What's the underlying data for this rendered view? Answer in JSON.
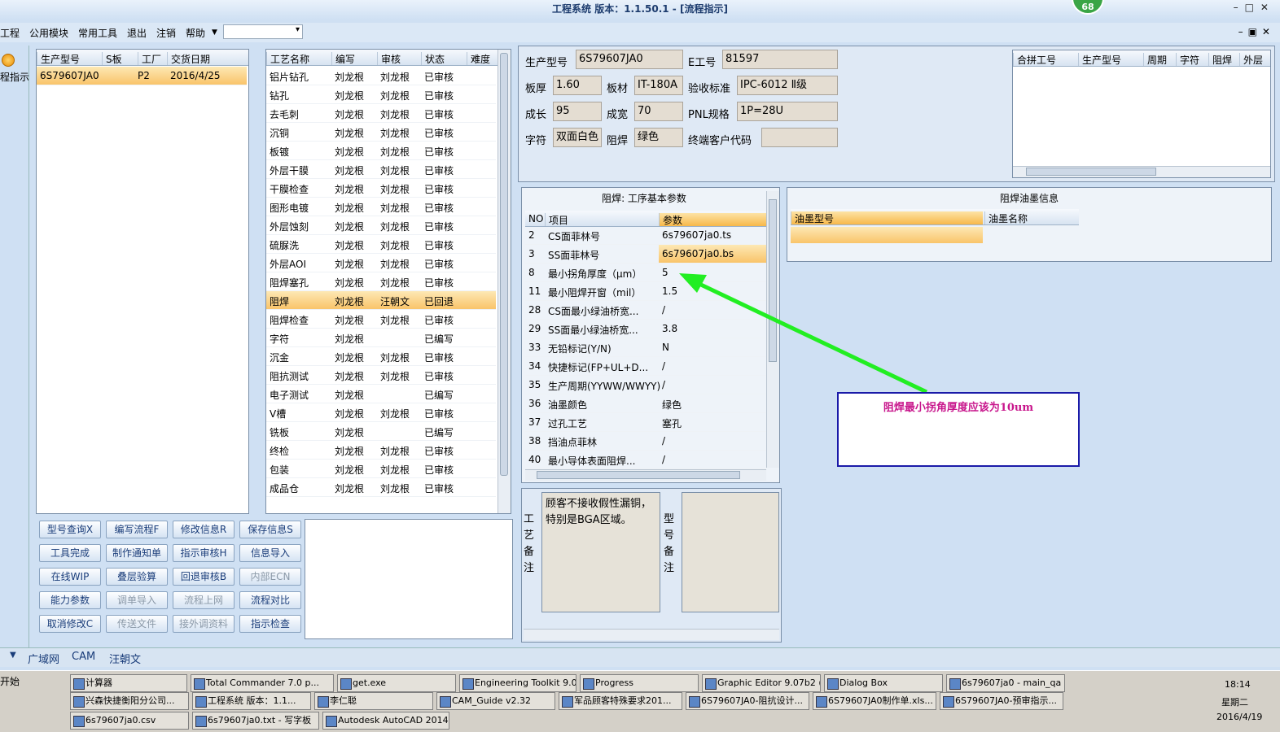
{
  "window": {
    "title": "工程系统   版本：1.1.50.1 - [流程指示]",
    "badge": "68"
  },
  "menu": {
    "items": [
      "工程",
      "公用模块",
      "常用工具",
      "退出",
      "注销",
      "帮助"
    ]
  },
  "sidebar": {
    "label": "程指示"
  },
  "orders": {
    "headers": [
      "生产型号",
      "S板",
      "工厂",
      "交货日期"
    ],
    "rows": [
      [
        "6S79607JA0",
        "",
        "P2",
        "2016/4/25"
      ]
    ]
  },
  "process": {
    "headers": [
      "工艺名称",
      "编写",
      "审核",
      "状态",
      "难度"
    ],
    "rows": [
      [
        "铝片钻孔",
        "刘龙根",
        "刘龙根",
        "已审核"
      ],
      [
        "钻孔",
        "刘龙根",
        "刘龙根",
        "已审核"
      ],
      [
        "去毛刺",
        "刘龙根",
        "刘龙根",
        "已审核"
      ],
      [
        "沉铜",
        "刘龙根",
        "刘龙根",
        "已审核"
      ],
      [
        "板镀",
        "刘龙根",
        "刘龙根",
        "已审核"
      ],
      [
        "外层干膜",
        "刘龙根",
        "刘龙根",
        "已审核"
      ],
      [
        "干膜检查",
        "刘龙根",
        "刘龙根",
        "已审核"
      ],
      [
        "图形电镀",
        "刘龙根",
        "刘龙根",
        "已审核"
      ],
      [
        "外层蚀刻",
        "刘龙根",
        "刘龙根",
        "已审核"
      ],
      [
        "硫脲洗",
        "刘龙根",
        "刘龙根",
        "已审核"
      ],
      [
        "外层AOI",
        "刘龙根",
        "刘龙根",
        "已审核"
      ],
      [
        "阻焊塞孔",
        "刘龙根",
        "刘龙根",
        "已审核"
      ],
      [
        "阻焊",
        "刘龙根",
        "汪朝文",
        "已回退"
      ],
      [
        "阻焊检查",
        "刘龙根",
        "刘龙根",
        "已审核"
      ],
      [
        "字符",
        "刘龙根",
        "",
        "已编写"
      ],
      [
        "沉金",
        "刘龙根",
        "刘龙根",
        "已审核"
      ],
      [
        "阻抗测试",
        "刘龙根",
        "刘龙根",
        "已审核"
      ],
      [
        "电子测试",
        "刘龙根",
        "",
        "已编写"
      ],
      [
        "V槽",
        "刘龙根",
        "刘龙根",
        "已审核"
      ],
      [
        "铣板",
        "刘龙根",
        "",
        "已编写"
      ],
      [
        "终检",
        "刘龙根",
        "刘龙根",
        "已审核"
      ],
      [
        "包装",
        "刘龙根",
        "刘龙根",
        "已审核"
      ],
      [
        "成品仓",
        "刘龙根",
        "刘龙根",
        "已审核"
      ]
    ]
  },
  "buttons": [
    [
      "型号查询X",
      "编写流程F",
      "修改信息R",
      "保存信息S"
    ],
    [
      "工具完成",
      "制作通知单",
      "指示审核H",
      "信息导入"
    ],
    [
      "在线WIP",
      "叠层验算",
      "回退审核B",
      "内部ECN"
    ],
    [
      "能力参数",
      "调单导入",
      "流程上网",
      "流程对比"
    ],
    [
      "取消修改C",
      "传送文件",
      "接外调资料",
      "指示检查"
    ]
  ],
  "info": {
    "model_label": "生产型号",
    "model": "6S79607JA0",
    "e_label": "E工号",
    "e": "81597",
    "thick_label": "板厚",
    "thick": "1.60",
    "mat_label": "板材",
    "mat": "IT-180A",
    "std_label": "验收标准",
    "std": "IPC-6012 Ⅱ级",
    "len_label": "成长",
    "len": "95",
    "wid_label": "成宽",
    "wid": "70",
    "pnl_label": "PNL规格",
    "pnl": "1P=28U",
    "char_label": "字符",
    "char": "双面白色",
    "mask_label": "阻焊",
    "mask": "绿色",
    "cust_label": "终端客户代码",
    "cust": ""
  },
  "merge": {
    "headers": [
      "合拼工号",
      "生产型号",
      "周期",
      "字符",
      "阻焊",
      "外层"
    ]
  },
  "params": {
    "title": "阻焊: 工序基本参数",
    "headers": [
      "NO",
      "项目",
      "参数"
    ],
    "rows": [
      [
        "2",
        "CS面菲林号",
        "6s79607ja0.ts"
      ],
      [
        "3",
        "SS面菲林号",
        "6s79607ja0.bs"
      ],
      [
        "8",
        "最小拐角厚度（μm）",
        "5"
      ],
      [
        "11",
        "最小阻焊开窗（mil）",
        "1.5"
      ],
      [
        "28",
        "CS面最小绿油桥宽...",
        "/"
      ],
      [
        "29",
        "SS面最小绿油桥宽...",
        "3.8"
      ],
      [
        "33",
        "无铅标记(Y/N)",
        "N"
      ],
      [
        "34",
        "快捷标记(FP+UL+D...",
        "/"
      ],
      [
        "35",
        "生产周期(YYWW/WWYY)",
        "/"
      ],
      [
        "36",
        "油墨颜色",
        "绿色"
      ],
      [
        "37",
        "过孔工艺",
        "塞孔"
      ],
      [
        "38",
        "挡油点菲林",
        "/"
      ],
      [
        "40",
        "最小导体表面阻焊...",
        "/"
      ]
    ]
  },
  "ink": {
    "title": "阻焊油墨信息",
    "headers": [
      "油墨型号",
      "油墨名称"
    ]
  },
  "annotation": {
    "text": "阻焊最小拐角厚度应该为10um"
  },
  "remarks": {
    "process_label": "工艺备注",
    "process_text": "顾客不接收假性漏铜，特别是BGA区域。",
    "model_label": "型号备注"
  },
  "status": {
    "items": [
      "广域网",
      "CAM",
      "汪朝文"
    ]
  },
  "taskbar": {
    "start": "开始",
    "tasks_row1": [
      "计算器",
      "Total Commander 7.0 p...",
      "get.exe",
      "Engineering Toolkit 9.0...",
      "Progress",
      "Graphic Editor 9.07b2 (...",
      "Dialog Box",
      "6s79607ja0 - main_qa"
    ],
    "tasks_row2": [
      "兴森快捷衡阳分公司...",
      "工程系统  版本：1.1...",
      "李仁聪",
      "CAM_Guide v2.32",
      "军品顾客特殊要求201...",
      "6S79607JA0-阻抗设计...",
      "6S79607JA0制作单.xls...",
      "6S79607JA0-预审指示..."
    ],
    "tasks_row3": [
      "6s79607ja0.csv",
      "6s79607ja0.txt - 写字板",
      "Autodesk AutoCAD 2014..."
    ],
    "time": "18:14",
    "weekday": "星期二",
    "date": "2016/4/19"
  }
}
